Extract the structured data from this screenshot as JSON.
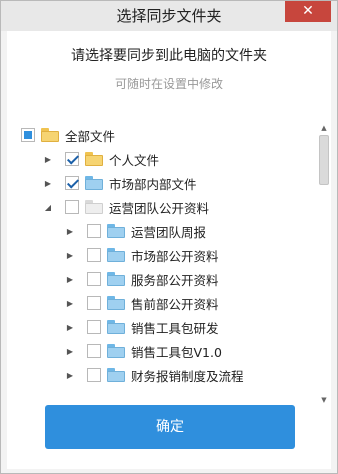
{
  "window": {
    "title": "选择同步文件夹",
    "close_label": "✕"
  },
  "main": {
    "heading": "请选择要同步到此电脑的文件夹",
    "subheading": "可随时在设置中修改",
    "confirm_label": "确定"
  },
  "tree": [
    {
      "label": "全部文件",
      "check": "partial",
      "folder": "yellow",
      "expand": "none"
    },
    {
      "label": "个人文件",
      "check": "checked",
      "folder": "yellow",
      "expand": "collapsed"
    },
    {
      "label": "市场部内部文件",
      "check": "checked",
      "folder": "blue",
      "expand": "collapsed"
    },
    {
      "label": "运营团队公开资料",
      "check": "unchecked",
      "folder": "gray",
      "expand": "expanded"
    },
    {
      "label": "运营团队周报",
      "check": "unchecked",
      "folder": "blue",
      "expand": "collapsed"
    },
    {
      "label": "市场部公开资料",
      "check": "unchecked",
      "folder": "blue",
      "expand": "collapsed"
    },
    {
      "label": "服务部公开资料",
      "check": "unchecked",
      "folder": "blue",
      "expand": "collapsed"
    },
    {
      "label": "售前部公开资料",
      "check": "unchecked",
      "folder": "blue",
      "expand": "collapsed"
    },
    {
      "label": "销售工具包研发",
      "check": "unchecked",
      "folder": "blue",
      "expand": "collapsed"
    },
    {
      "label": "销售工具包V1.0",
      "check": "unchecked",
      "folder": "blue",
      "expand": "collapsed"
    },
    {
      "label": "财务报销制度及流程",
      "check": "unchecked",
      "folder": "blue",
      "expand": "collapsed"
    }
  ],
  "colors": {
    "accent": "#2f8fdd",
    "close": "#c7463d"
  }
}
